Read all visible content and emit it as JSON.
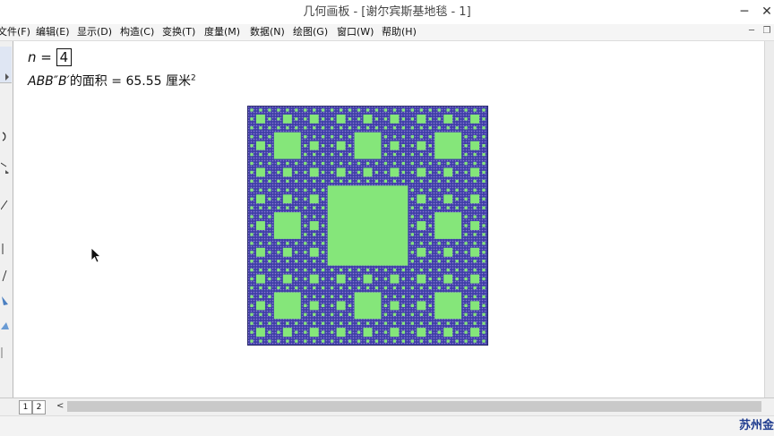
{
  "window": {
    "title": "几何画板 - [谢尔宾斯基地毯 - 1]",
    "minimize_glyph": "─",
    "close_glyph": "✕"
  },
  "menu": [
    {
      "id": "file",
      "label": "文件(F)"
    },
    {
      "id": "edit",
      "label": "编辑(E)"
    },
    {
      "id": "display",
      "label": "显示(D)"
    },
    {
      "id": "construct",
      "label": "构造(C)"
    },
    {
      "id": "transform",
      "label": "变换(T)"
    },
    {
      "id": "measure",
      "label": "度量(M)"
    },
    {
      "id": "data",
      "label": "数据(N)"
    },
    {
      "id": "graph",
      "label": "绘图(G)"
    },
    {
      "id": "window",
      "label": "窗口(W)"
    },
    {
      "id": "help",
      "label": "帮助(H)"
    }
  ],
  "mdi": {
    "minimize_glyph": "─",
    "restore_glyph": "❐"
  },
  "canvas": {
    "parameter": {
      "name": "n",
      "equals": "=",
      "value": "4"
    },
    "measurement": {
      "label": "ABB″B′",
      "suffix": "的面积 = ",
      "value": "65.55",
      "unit": "厘米",
      "exponent": "2"
    },
    "carpet": {
      "iterations": 4,
      "fill_color": "#3f3fa6",
      "hole_color": "#85e67a",
      "grid_color": "#8c78d8"
    }
  },
  "pages": {
    "tab1": "1",
    "tab2": "2",
    "scroll_left_glyph": "<"
  },
  "status": {
    "text": "苏州金"
  }
}
